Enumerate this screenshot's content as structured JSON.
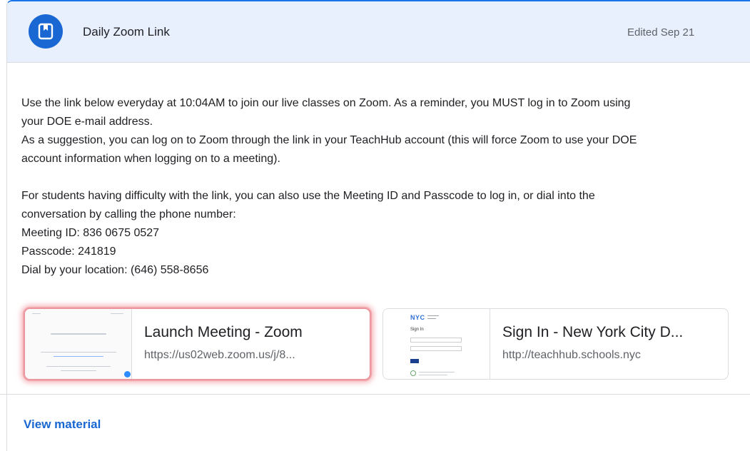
{
  "header": {
    "title": "Daily Zoom Link",
    "edited": "Edited Sep 21"
  },
  "body": {
    "p1_line1": "Use the link below everyday at 10:04AM to join our live classes on Zoom.  As a reminder, you MUST log in to Zoom using",
    "p1_line2": "your DOE e-mail address.",
    "p2_line1": "As a suggestion, you can log on to Zoom through the link in your TeachHub account (this will force Zoom to use your DOE",
    "p2_line2": "account information when logging on to a meeting).",
    "p3_line1": "For students having difficulty with the link, you can also use the Meeting ID and Passcode to log in, or dial into the",
    "p3_line2": "conversation by calling the phone number:",
    "meeting_id": "Meeting ID: 836 0675 0527",
    "passcode": "Passcode: 241819",
    "dial": "Dial by your location: (646) 558-8656"
  },
  "attachments": [
    {
      "title": "Launch Meeting - Zoom",
      "url": "https://us02web.zoom.us/j/8...",
      "icon": "zoom-thumbnail"
    },
    {
      "title": "Sign In - New York City D...",
      "url": "http://teachhub.schools.nyc",
      "icon": "nyc-doe-thumbnail"
    }
  ],
  "thumbs": {
    "nyc_logo": "NYC",
    "sign_in": "Sign In"
  },
  "footer": {
    "view_material": "View material"
  },
  "colors": {
    "accent": "#1967d2",
    "header_bg": "#e8f0fe",
    "highlight": "#e88e96"
  }
}
